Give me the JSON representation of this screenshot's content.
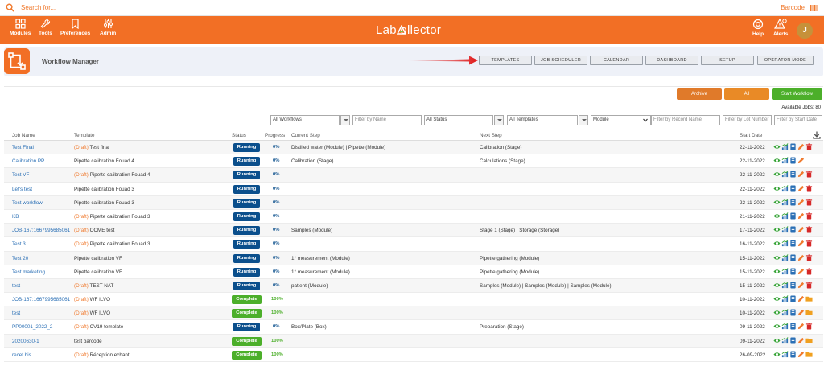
{
  "search": {
    "placeholder": "Search for...",
    "barcode_label": "Barcode"
  },
  "nav": {
    "modules": "Modules",
    "tools": "Tools",
    "preferences": "Preferences",
    "admin": "Admin",
    "logo": "Lab ollector",
    "help": "Help",
    "alerts": "Alerts",
    "avatar_initial": "J"
  },
  "page": {
    "title": "Workflow Manager",
    "buttons": [
      "TEMPLATES",
      "JOB SCHEDULER",
      "CALENDAR",
      "DASHBOARD",
      "SETUP",
      "OPERATOR MODE"
    ]
  },
  "actions": {
    "archive": "Archive",
    "all": "All",
    "start_workflow": "Start Workflow",
    "available_jobs": "Available Jobs: 80"
  },
  "filters": {
    "workflows": "All Workflows",
    "name_placeholder": "Filter by Name",
    "status": "All Status",
    "templates": "All Templates",
    "module": "Module",
    "record_placeholder": "Filter by Record Name",
    "lot_placeholder": "Filter by Lot Number",
    "start_date_placeholder": "Filter by Start Date"
  },
  "table": {
    "columns": [
      "Job Name",
      "Template",
      "Status",
      "Progress",
      "Current Step",
      "Next Step",
      "Start Date"
    ],
    "rows": [
      {
        "name": "Test Final",
        "draft": "(Draft)",
        "template": " Test final",
        "status": "Running",
        "progress": "0%",
        "current": "Distilled water (Module) | Pipette (Module)",
        "next": "Calibration (Stage)",
        "date": "22-11-2022",
        "last_icon": "trash"
      },
      {
        "name": "Calibration PP",
        "draft": "",
        "template": "Pipette calibration Fouad 4",
        "status": "Running",
        "progress": "0%",
        "current": "Calibration (Stage)",
        "next": "Calculations (Stage)",
        "date": "22-11-2022",
        "last_icon": "none"
      },
      {
        "name": "Test VF",
        "draft": "(Draft)",
        "template": " Pipette calibration Fouad 4",
        "status": "Running",
        "progress": "0%",
        "current": "",
        "next": "",
        "date": "22-11-2022",
        "last_icon": "trash"
      },
      {
        "name": "Let's test",
        "draft": "",
        "template": "Pipette calibration Fouad 3",
        "status": "Running",
        "progress": "0%",
        "current": "",
        "next": "",
        "date": "22-11-2022",
        "last_icon": "trash"
      },
      {
        "name": "Test workflow",
        "draft": "",
        "template": "Pipette calibration Fouad 3",
        "status": "Running",
        "progress": "0%",
        "current": "",
        "next": "",
        "date": "22-11-2022",
        "last_icon": "trash"
      },
      {
        "name": "KB",
        "draft": "(Draft)",
        "template": " Pipette calibration Fouad 3",
        "status": "Running",
        "progress": "0%",
        "current": "",
        "next": "",
        "date": "21-11-2022",
        "last_icon": "trash"
      },
      {
        "name": "JOB-167:1667995685061",
        "draft": "(Draft)",
        "template": " OCME test",
        "status": "Running",
        "progress": "0%",
        "current": "Samples (Module)",
        "next": "Stage 1 (Stage) | Storage (Storage)",
        "date": "17-11-2022",
        "last_icon": "trash"
      },
      {
        "name": "Test 3",
        "draft": "(Draft)",
        "template": " Pipette calibration Fouad 3",
        "status": "Running",
        "progress": "0%",
        "current": "",
        "next": "",
        "date": "16-11-2022",
        "last_icon": "trash"
      },
      {
        "name": "Test 20",
        "draft": "",
        "template": "Pipette calibration VF",
        "status": "Running",
        "progress": "0%",
        "current": "1° measurement (Module)",
        "next": "Pipette gathering (Module)",
        "date": "15-11-2022",
        "last_icon": "trash"
      },
      {
        "name": "Test marketing",
        "draft": "",
        "template": "Pipette calibration VF",
        "status": "Running",
        "progress": "0%",
        "current": "1° measurement (Module)",
        "next": "Pipette gathering (Module)",
        "date": "15-11-2022",
        "last_icon": "trash"
      },
      {
        "name": "test",
        "draft": "(Draft)",
        "template": " TEST NAT",
        "status": "Running",
        "progress": "0%",
        "current": "patient (Module)",
        "next": "Samples (Module) | Samples (Module) | Samples (Module)",
        "date": "15-11-2022",
        "last_icon": "trash"
      },
      {
        "name": "JOB-167:1667995685061",
        "draft": "(Draft)",
        "template": " WF ILVO",
        "status": "Complete",
        "progress": "100%",
        "current": "",
        "next": "",
        "date": "10-11-2022",
        "last_icon": "folder"
      },
      {
        "name": "test",
        "draft": "(Draft)",
        "template": " WF ILVO",
        "status": "Complete",
        "progress": "100%",
        "current": "",
        "next": "",
        "date": "10-11-2022",
        "last_icon": "folder"
      },
      {
        "name": "PP00001_2022_2",
        "draft": "(Draft)",
        "template": " CV19 template",
        "status": "Running",
        "progress": "0%",
        "current": "Box/Plate (Box)",
        "next": "Preparation (Stage)",
        "date": "09-11-2022",
        "last_icon": "trash"
      },
      {
        "name": "20200630-1",
        "draft": "",
        "template": "test barcode",
        "status": "Complete",
        "progress": "100%",
        "current": "",
        "next": "",
        "date": "09-11-2022",
        "last_icon": "folder"
      },
      {
        "name": "recet bis",
        "draft": "(Draft)",
        "template": " Réception echant",
        "status": "Complete",
        "progress": "100%",
        "current": "",
        "next": "",
        "date": "26-09-2022",
        "last_icon": "folder"
      }
    ]
  },
  "colors": {
    "brand": "#f26f25",
    "running": "#0b4f8c",
    "complete": "#4caf2a",
    "link": "#2a6fb5",
    "archive": "#e07a2a",
    "start": "#4caf2a"
  }
}
